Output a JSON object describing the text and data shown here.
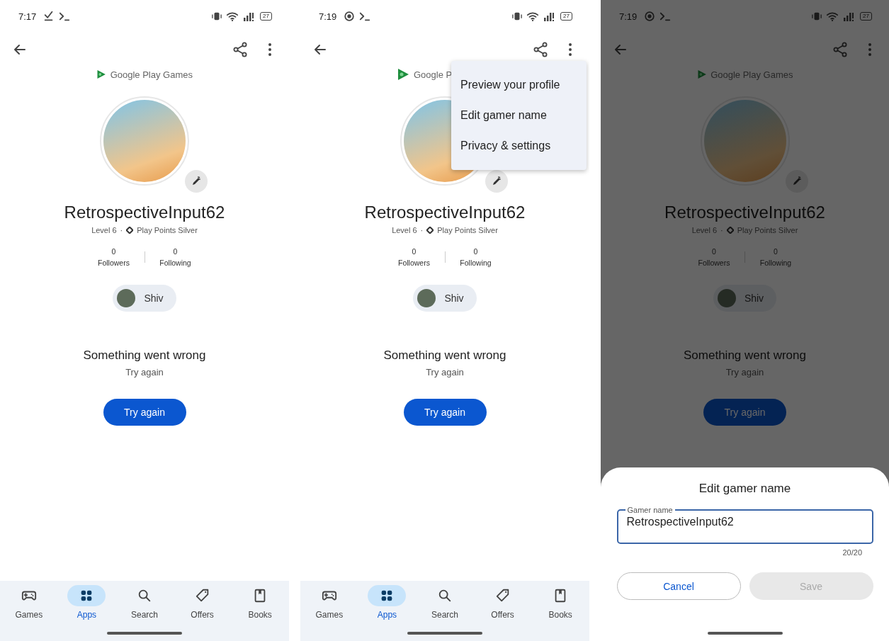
{
  "screens": [
    {
      "status_bar": {
        "time": "7:17",
        "notification_icons": [
          {
            "kind": "download"
          },
          {
            "kind": "terminal"
          }
        ],
        "battery": "27"
      },
      "brand": "Google Play Games",
      "profile": {
        "name": "RetrospectiveInput62",
        "level": "Level 6",
        "separator": "·",
        "tier": "Play Points Silver",
        "stats": [
          {
            "count": "0",
            "label": "Followers"
          },
          {
            "count": "0",
            "label": "Following"
          }
        ],
        "friend": "Shiv"
      },
      "error": {
        "title": "Something went wrong",
        "message": "Try again",
        "button": "Try again"
      },
      "bottom_nav": [
        {
          "label": "Games",
          "kind": "games",
          "selected": false
        },
        {
          "label": "Apps",
          "kind": "apps",
          "selected": true
        },
        {
          "label": "Search",
          "kind": "search",
          "selected": false
        },
        {
          "label": "Offers",
          "kind": "offers",
          "selected": false
        },
        {
          "label": "Books",
          "kind": "books",
          "selected": false
        }
      ]
    },
    {
      "status_bar": {
        "time": "7:19",
        "notification_icons": [
          {
            "kind": "record"
          },
          {
            "kind": "terminal"
          }
        ],
        "battery": "27"
      },
      "brand": "Google P",
      "profile": {
        "name": "RetrospectiveInput62",
        "level": "Level 6",
        "separator": "·",
        "tier": "Play Points Silver",
        "stats": [
          {
            "count": "0",
            "label": "Followers"
          },
          {
            "count": "0",
            "label": "Following"
          }
        ],
        "friend": "Shiv"
      },
      "error": {
        "title": "Something went wrong",
        "message": "Try again",
        "button": "Try again"
      },
      "menu": {
        "items": [
          "Preview your profile",
          "Edit gamer name",
          "Privacy & settings"
        ]
      },
      "bottom_nav": [
        {
          "label": "Games",
          "kind": "games",
          "selected": false
        },
        {
          "label": "Apps",
          "kind": "apps",
          "selected": true
        },
        {
          "label": "Search",
          "kind": "search",
          "selected": false
        },
        {
          "label": "Offers",
          "kind": "offers",
          "selected": false
        },
        {
          "label": "Books",
          "kind": "books",
          "selected": false
        }
      ]
    },
    {
      "status_bar": {
        "time": "7:19",
        "notification_icons": [
          {
            "kind": "record"
          },
          {
            "kind": "terminal"
          }
        ],
        "battery": "27"
      },
      "brand": "Google Play Games",
      "profile": {
        "name": "RetrospectiveInput62",
        "level": "Level 6",
        "separator": "·",
        "tier": "Play Points Silver",
        "stats": [
          {
            "count": "0",
            "label": "Followers"
          },
          {
            "count": "0",
            "label": "Following"
          }
        ],
        "friend": "Shiv"
      },
      "error": {
        "title": "Something went wrong",
        "message": "Try again",
        "button": "Try again"
      },
      "dimmed": true,
      "sheet": {
        "title": "Edit gamer name",
        "field": {
          "label": "Gamer name",
          "value": "RetrospectiveInput62",
          "counter": "20/20"
        },
        "buttons": [
          {
            "label": "Cancel",
            "kind": "outlined",
            "disabled": false
          },
          {
            "label": "Save",
            "kind": "filled",
            "disabled": true
          }
        ]
      }
    }
  ]
}
